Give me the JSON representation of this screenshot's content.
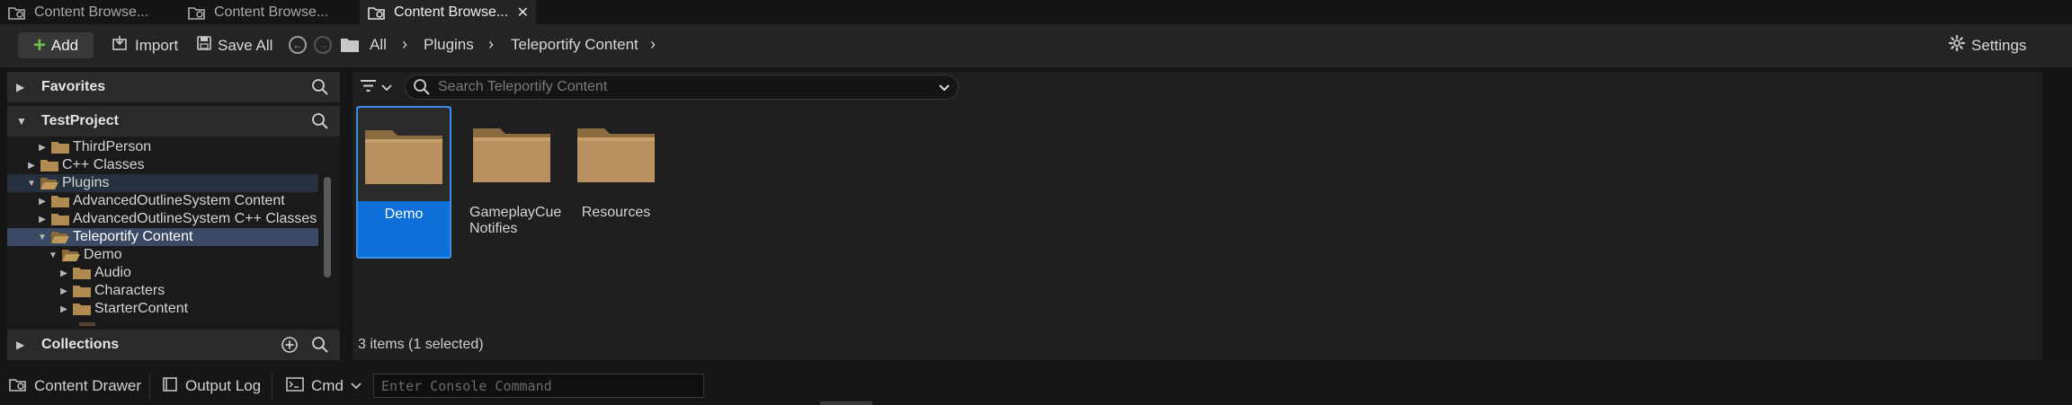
{
  "tabs": [
    {
      "label": "Content Browse...",
      "active": false
    },
    {
      "label": "Content Browse...",
      "active": false
    },
    {
      "label": "Content Browse...",
      "active": true,
      "close": "✕"
    }
  ],
  "toolbar": {
    "add_label": "Add",
    "import_label": "Import",
    "save_all_label": "Save All",
    "settings_label": "Settings",
    "breadcrumb": [
      "All",
      "Plugins",
      "Teleportify Content"
    ]
  },
  "sidebar": {
    "favorites_label": "Favorites",
    "project_label": "TestProject",
    "collections_label": "Collections",
    "tree": [
      {
        "label": "ThirdPerson",
        "depth": 2,
        "expand": "right"
      },
      {
        "label": "C++ Classes",
        "depth": 1,
        "expand": "right"
      },
      {
        "label": "Plugins",
        "depth": 1,
        "expand": "down",
        "state": "hl"
      },
      {
        "label": "AdvancedOutlineSystem Content",
        "depth": 2,
        "expand": "right"
      },
      {
        "label": "AdvancedOutlineSystem C++ Classes",
        "depth": 2,
        "expand": "right"
      },
      {
        "label": "Teleportify Content",
        "depth": 2,
        "expand": "down",
        "state": "sel"
      },
      {
        "label": "Demo",
        "depth": 3,
        "expand": "down"
      },
      {
        "label": "Audio",
        "depth": 4,
        "expand": "right"
      },
      {
        "label": "Characters",
        "depth": 4,
        "expand": "right"
      },
      {
        "label": "StarterContent",
        "depth": 4,
        "expand": "right"
      }
    ]
  },
  "content": {
    "search_placeholder": "Search Teleportify Content",
    "items": [
      {
        "label": "Demo",
        "selected": true
      },
      {
        "label": "GameplayCue Notifies",
        "selected": false
      },
      {
        "label": "Resources",
        "selected": false
      }
    ],
    "status": "3 items (1 selected)"
  },
  "bottombar": {
    "content_drawer_label": "Content Drawer",
    "output_log_label": "Output Log",
    "cmd_label": "Cmd",
    "console_placeholder": "Enter Console Command"
  },
  "colors": {
    "accent_green": "#6fc04a",
    "selection_blue": "#0d6fd8",
    "folder": "#b08a50"
  }
}
